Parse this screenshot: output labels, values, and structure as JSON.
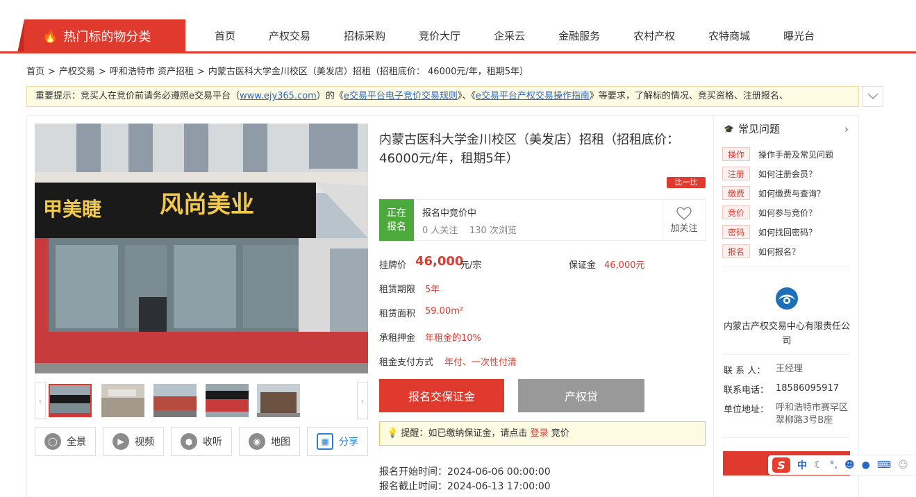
{
  "nav": {
    "category_label": "热门标的物分类",
    "items": [
      "首页",
      "产权交易",
      "招标采购",
      "竞价大厅",
      "企采云",
      "金融服务",
      "农村产权",
      "农特商城",
      "曝光台"
    ]
  },
  "breadcrumb": [
    "首页",
    "产权交易",
    "呼和浩特市 资产招租",
    "内蒙古医科大学金川校区（美发店）招租（招租底价： 46000元/年，租期5年）"
  ],
  "notice": {
    "prefix": "重要提示：竞买人在竞价前请务必遵照e交易平台（",
    "site_link": "www.ejy365.com",
    "mid1": "）的《",
    "rule_link": "e交易平台电子竞价交易规则",
    "mid2": "》、《",
    "guide_link": "e交易平台产权交易操作指南",
    "suffix": "》等要求，了解标的情况、竞买资格、注册报名、"
  },
  "listing": {
    "title": "内蒙古医科大学金川校区（美发店）招租（招租底价： 46000元/年，租期5年）",
    "compare_label": "比一比",
    "status_tag": "正在报名",
    "status_text": "报名中竞价中",
    "followers": "0",
    "followers_unit": "人关注",
    "views": "130",
    "views_unit": "次浏览",
    "follow_label": "加关注",
    "price_label": "挂牌价",
    "price": "46,000",
    "price_unit": "元/宗",
    "deposit_label": "保证金",
    "deposit": "46,000元",
    "lease_term_label": "租赁期限",
    "lease_term": "5年",
    "area_label": "租赁面积",
    "area": "59.00m²",
    "rent_deposit_label": "承租押金",
    "rent_deposit": "年租金的10%",
    "payment_label": "租金支付方式",
    "payment": "年付、一次性付清",
    "btn_deposit": "报名交保证金",
    "btn_loan": "产权贷",
    "reminder_prefix": "提醒：如已缴纳保证金，请点击",
    "reminder_link": "登录",
    "reminder_suffix": "竞价",
    "start_time": "报名开始时间：2024-06-06 00:00:00",
    "end_time": "报名截止时间：2024-06-13 17:00:00"
  },
  "photo": {
    "sign_left": "甲美睫",
    "sign_right": "风尚美业"
  },
  "tools": [
    "全景",
    "视频",
    "收听",
    "地图",
    "分享"
  ],
  "faq": {
    "title": "常见问题",
    "items": [
      {
        "tag": "操作",
        "text": "操作手册及常见问题"
      },
      {
        "tag": "注册",
        "text": "如何注册会员？"
      },
      {
        "tag": "缴费",
        "text": "如何缴费与查询？"
      },
      {
        "tag": "竞价",
        "text": "如何参与竞价？"
      },
      {
        "tag": "密码",
        "text": "如何找回密码？"
      },
      {
        "tag": "报名",
        "text": "如何报名？"
      }
    ]
  },
  "org": {
    "name": "内蒙古产权交易中心有限责任公司",
    "contact_label": "联 系 人：",
    "contact": "王经理",
    "phone_label": "联系电话：",
    "phone": "18586095917",
    "address_label": "单位地址：",
    "address": "呼和浩特市赛罕区翠柳路3号B座"
  },
  "ime": {
    "logo": "S",
    "mode": "中"
  },
  "colors": {
    "brand_red": "#e03a2f",
    "status_green": "#4caa3d",
    "link_blue": "#2a67c6"
  }
}
